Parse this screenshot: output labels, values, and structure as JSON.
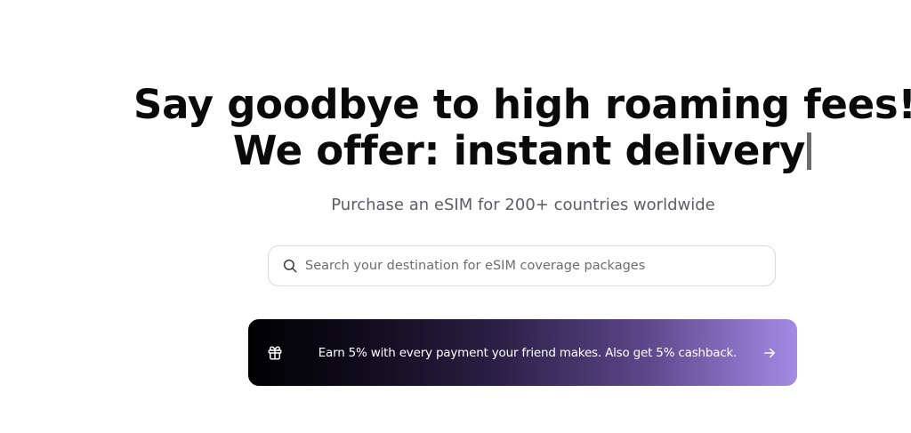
{
  "hero": {
    "title_line_1": "Say goodbye to high roaming fees!",
    "title_line_2": "We offer: instant delivery"
  },
  "subtitle": "Purchase an eSIM for 200+ countries worldwide",
  "search": {
    "placeholder": "Search your destination for eSIM coverage packages",
    "value": "",
    "icon": "search-icon"
  },
  "promo": {
    "text": "Earn 5% with every payment your friend makes. Also get 5% cashback.",
    "leading_icon": "gift-icon",
    "trailing_icon": "arrow-right-icon",
    "gradient_start": "#000000",
    "gradient_end": "#a58ae6"
  },
  "colors": {
    "title": "#0a0a0a",
    "subtitle": "#5c5c66",
    "cursor": "#6b6b6b",
    "search_border": "#d9d9de"
  }
}
